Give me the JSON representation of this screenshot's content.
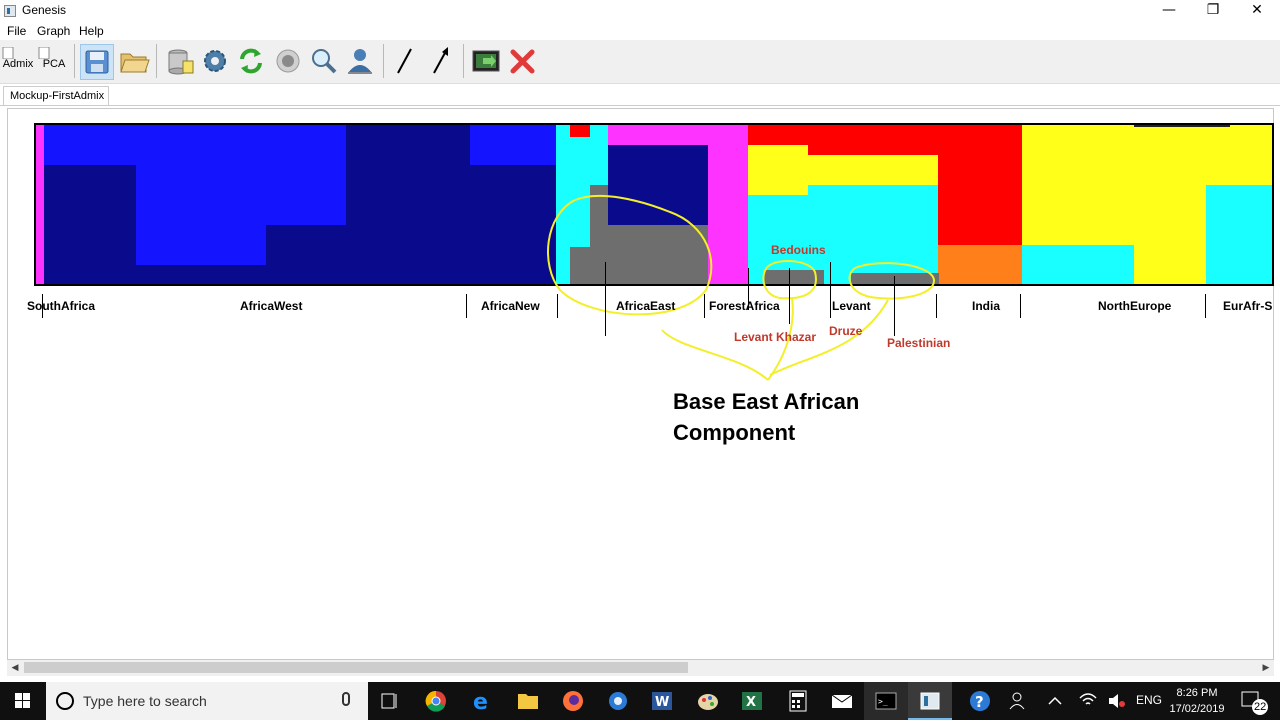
{
  "window": {
    "title": "Genesis",
    "controls": {
      "minimize": "—",
      "restore": "❐",
      "close": "✕"
    }
  },
  "menu": [
    "File",
    "Graph",
    "Help"
  ],
  "toolbar": {
    "admix_label": "Admix",
    "pca_label": "PCA",
    "icons": [
      "save-icon",
      "open-folder-icon",
      "database-icon",
      "settings-gear-icon",
      "refresh-icon",
      "record-icon",
      "search-icon",
      "person-icon",
      "line-icon",
      "arrow-icon",
      "export-image-icon",
      "close-red-icon"
    ]
  },
  "tab": {
    "label": "Mockup-FirstAdmix"
  },
  "plot": {
    "regions": [
      "SouthAfrica",
      "AfricaWest",
      "AfricaNew",
      "AfricaEast",
      "ForestAfrica",
      "Levant",
      "India",
      "NorthEurope",
      "EurAfr-S"
    ],
    "annotations": {
      "bedouins": "Bedouins",
      "levant_khazar": "Levant Khazar",
      "druze": "Druze",
      "palestinian": "Palestinian",
      "base_line1": "Base East African",
      "base_line2": "Component"
    },
    "colors": {
      "navy": "#0a0a8c",
      "blue": "#1414ff",
      "magenta": "#ff33ff",
      "cyan": "#19ffff",
      "gray": "#6e6e6e",
      "red": "#ff0000",
      "yellow": "#ffff1a",
      "orange": "#ff7f1a",
      "annotation_circle": "#f3ef2a"
    }
  },
  "taskbar": {
    "search_placeholder": "Type here to search",
    "language": "ENG",
    "time": "8:26 PM",
    "date": "17/02/2019",
    "notification_count": "22"
  }
}
